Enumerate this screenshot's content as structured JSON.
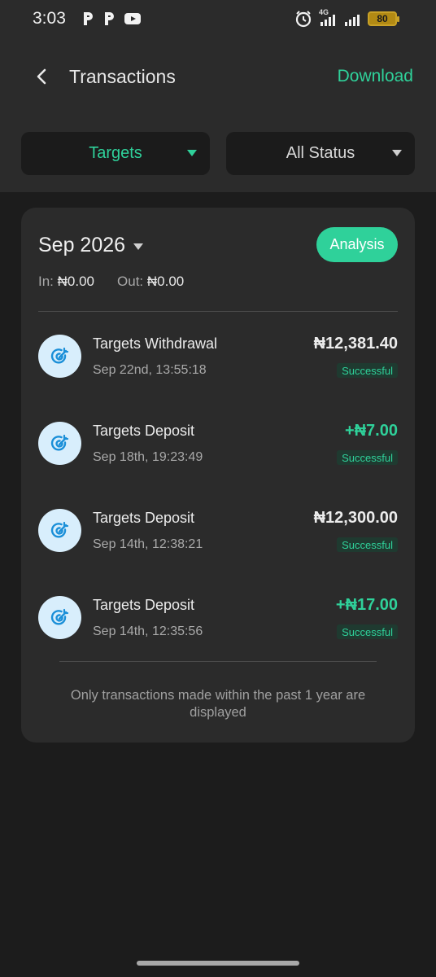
{
  "status_bar": {
    "time": "3:03",
    "left_icons": [
      "p-icon",
      "p-icon",
      "youtube-icon"
    ],
    "network": "4G",
    "battery": "80"
  },
  "header": {
    "title": "Transactions",
    "download_label": "Download"
  },
  "filters": {
    "category": "Targets",
    "status": "All Status"
  },
  "summary": {
    "month": "Sep 2026",
    "analysis_label": "Analysis",
    "in_label": "In:",
    "in_amount": "₦0.00",
    "out_label": "Out:",
    "out_amount": "₦0.00"
  },
  "transactions": [
    {
      "title": "Targets Withdrawal",
      "date": "Sep 22nd, 13:55:18",
      "amount": "₦12,381.40",
      "status": "Successful",
      "type": "debit",
      "icon": "target-icon"
    },
    {
      "title": "Targets Deposit",
      "date": "Sep 18th, 19:23:49",
      "amount": "+₦7.00",
      "status": "Successful",
      "type": "credit",
      "icon": "target-icon"
    },
    {
      "title": "Targets Deposit",
      "date": "Sep 14th, 12:38:21",
      "amount": "₦12,300.00",
      "status": "Successful",
      "type": "debit",
      "icon": "target-icon"
    },
    {
      "title": "Targets Deposit",
      "date": "Sep 14th, 12:35:56",
      "amount": "+₦17.00",
      "status": "Successful",
      "type": "credit",
      "icon": "target-icon"
    }
  ],
  "footnote": "Only transactions made within the past 1 year are displayed",
  "colors": {
    "accent": "#2fd19a",
    "background": "#1c1c1c",
    "card": "#2b2b2b",
    "icon_bg": "#d8eefc",
    "icon_fg": "#1a8fd8"
  }
}
